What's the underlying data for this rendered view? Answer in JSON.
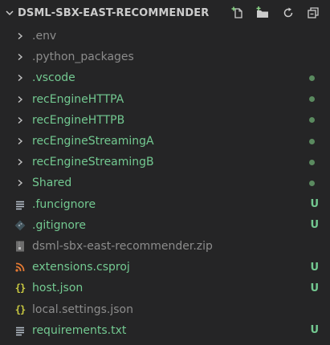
{
  "header": {
    "title": "DSML-SBX-EAST-RECOMMENDER",
    "actions": [
      {
        "name": "new-file-button",
        "icon": "new-file-icon"
      },
      {
        "name": "new-folder-button",
        "icon": "new-folder-icon"
      },
      {
        "name": "refresh-button",
        "icon": "refresh-icon"
      },
      {
        "name": "collapse-all-button",
        "icon": "collapse-all-icon"
      }
    ]
  },
  "colors": {
    "background": "#252526",
    "ignored_text": "#8c8c8c",
    "untracked_text": "#73c991",
    "dot": "#5a8a5f",
    "u_badge": "#73c991"
  },
  "items": [
    {
      "label": ".env",
      "kind": "folder",
      "status": "ignored",
      "badge": ""
    },
    {
      "label": ".python_packages",
      "kind": "folder",
      "status": "ignored",
      "badge": ""
    },
    {
      "label": ".vscode",
      "kind": "folder",
      "status": "untracked",
      "badge": "dot"
    },
    {
      "label": "recEngineHTTPA",
      "kind": "folder",
      "status": "untracked",
      "badge": "dot"
    },
    {
      "label": "recEngineHTTPB",
      "kind": "folder",
      "status": "untracked",
      "badge": "dot"
    },
    {
      "label": "recEngineStreamingA",
      "kind": "folder",
      "status": "untracked",
      "badge": "dot"
    },
    {
      "label": "recEngineStreamingB",
      "kind": "folder",
      "status": "untracked",
      "badge": "dot"
    },
    {
      "label": "Shared",
      "kind": "folder",
      "status": "untracked",
      "badge": "dot"
    },
    {
      "label": ".funcignore",
      "kind": "file",
      "icon": "lines-icon",
      "status": "untracked",
      "badge": "U"
    },
    {
      "label": ".gitignore",
      "kind": "file",
      "icon": "git-icon",
      "status": "untracked",
      "badge": "U"
    },
    {
      "label": "dsml-sbx-east-recommender.zip",
      "kind": "file",
      "icon": "zip-icon",
      "status": "ignored",
      "badge": ""
    },
    {
      "label": "extensions.csproj",
      "kind": "file",
      "icon": "rss-icon",
      "status": "untracked",
      "badge": "U"
    },
    {
      "label": "host.json",
      "kind": "file",
      "icon": "json-icon",
      "status": "untracked",
      "badge": "U"
    },
    {
      "label": "local.settings.json",
      "kind": "file",
      "icon": "json-icon",
      "status": "ignored",
      "badge": ""
    },
    {
      "label": "requirements.txt",
      "kind": "file",
      "icon": "lines-icon",
      "status": "untracked",
      "badge": "U"
    }
  ]
}
